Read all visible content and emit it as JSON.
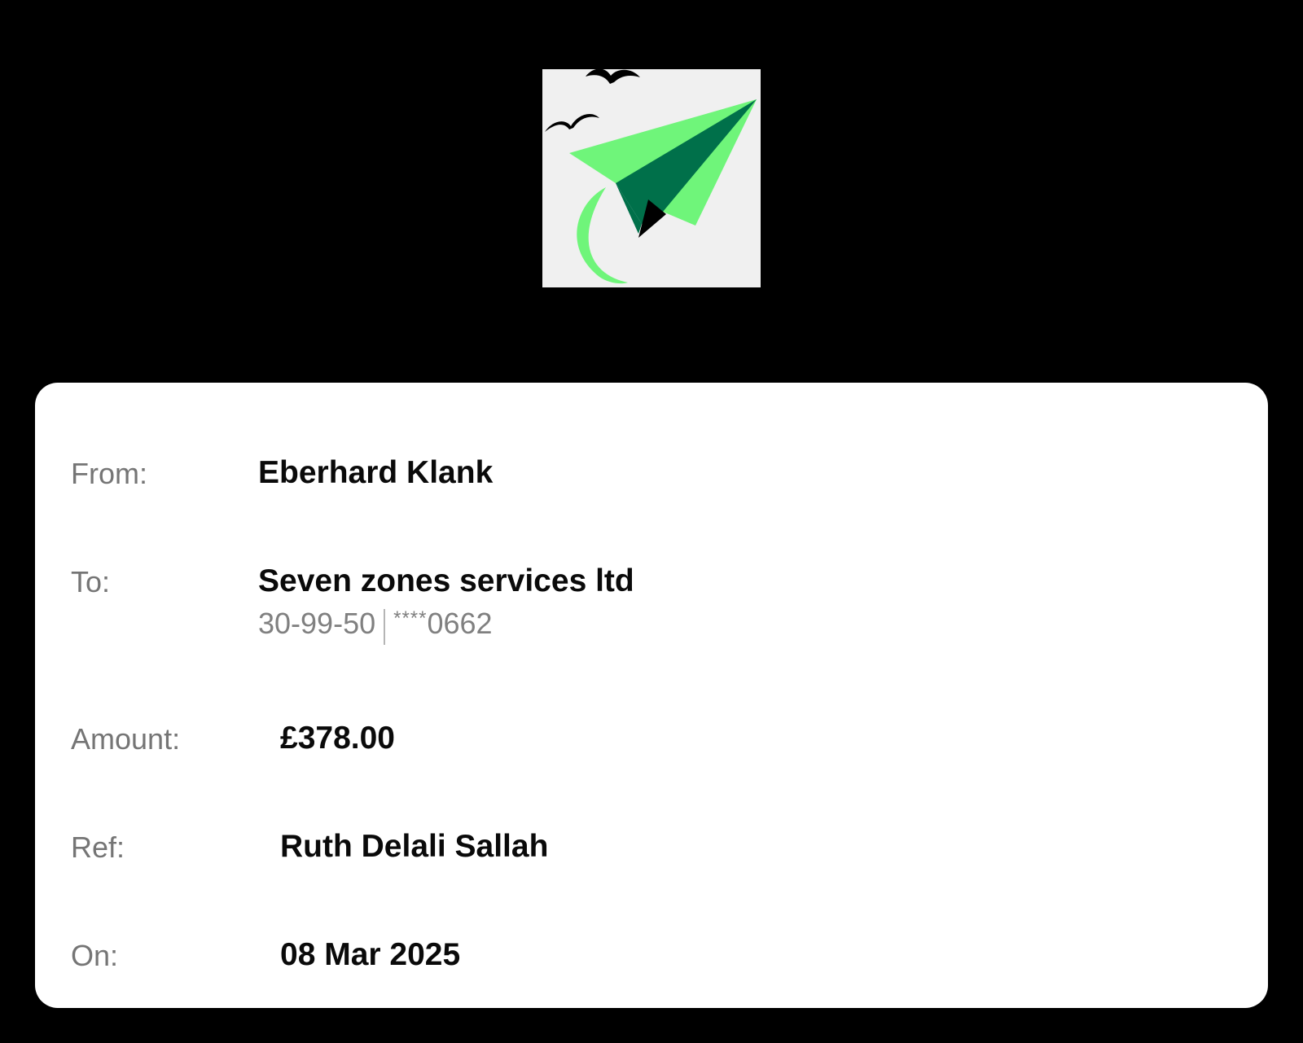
{
  "logo": {
    "icon": "paper-plane-logo-icon",
    "colors": {
      "background": "#f0f0f0",
      "light_green": "#6ff57a",
      "dark_green": "#00704a",
      "black": "#000000"
    }
  },
  "transfer": {
    "from_label": "From:",
    "from_value": "Eberhard Klank",
    "to_label": "To:",
    "to_value": "Seven zones services ltd",
    "sort_code": "30-99-50",
    "account_mask": "****",
    "account_last4": "0662",
    "amount_label": "Amount:",
    "amount_value": "£378.00",
    "ref_label": "Ref:",
    "ref_value": "Ruth Delali Sallah",
    "on_label": "On:",
    "on_value": "08 Mar 2025"
  }
}
